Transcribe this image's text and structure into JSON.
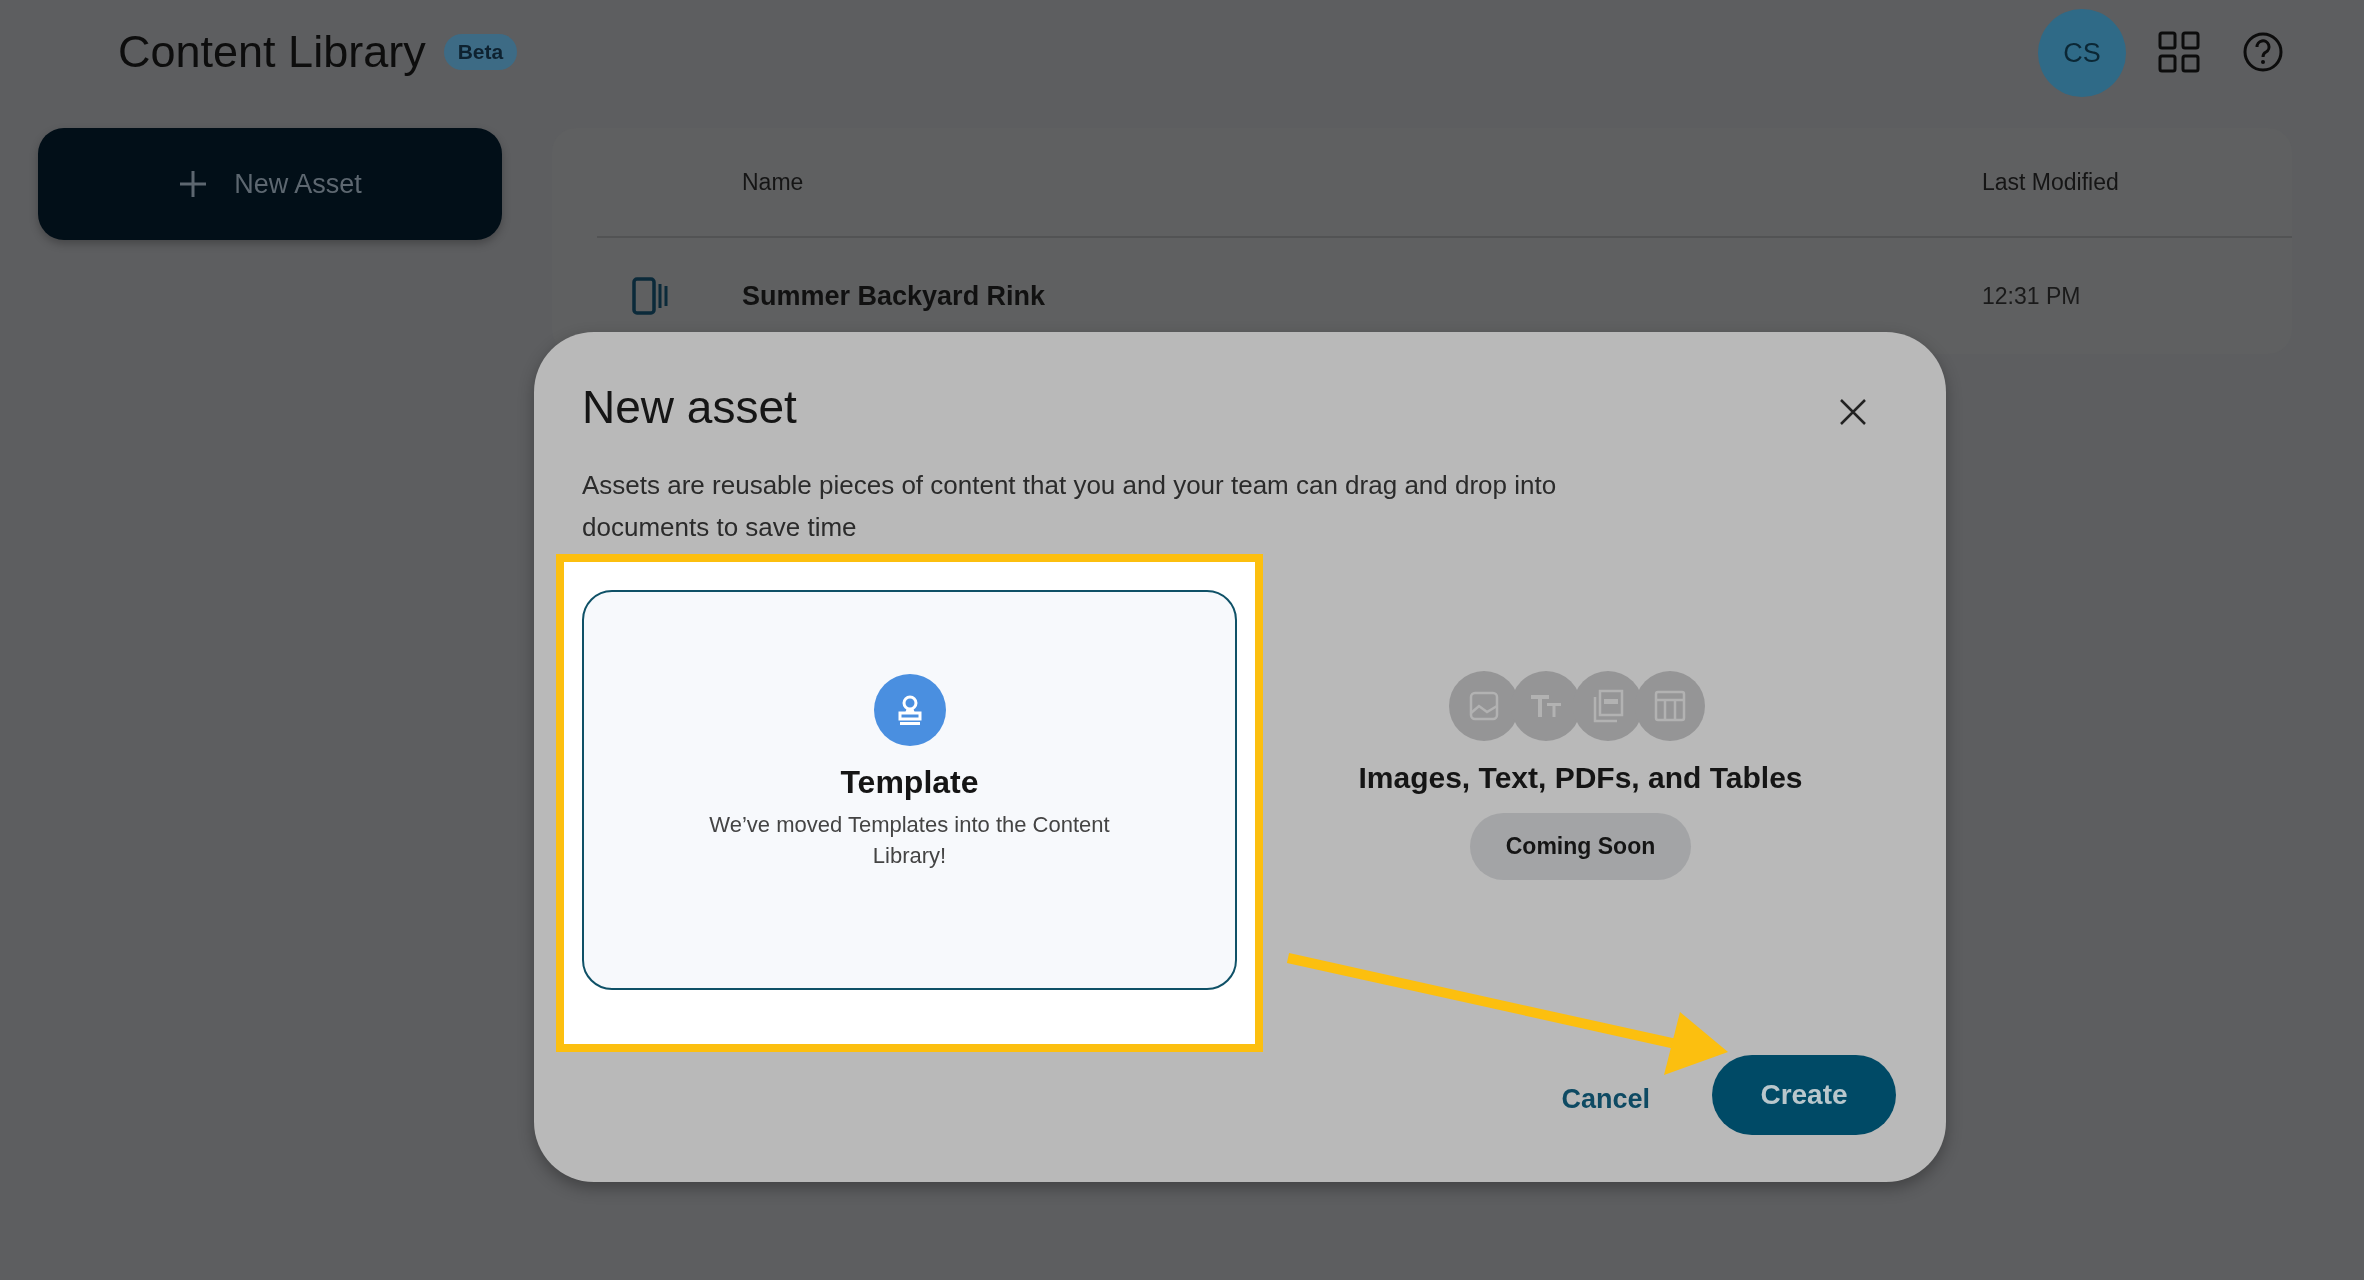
{
  "header": {
    "title": "Content Library",
    "badge": "Beta",
    "avatar": "CS"
  },
  "sidebar": {
    "new_button": "New Asset"
  },
  "table": {
    "columns": [
      "Name",
      "Last Modified"
    ],
    "rows": [
      {
        "name": "Summer Backyard Rink",
        "last_modified": "12:31 PM"
      }
    ]
  },
  "dialog": {
    "title": "New asset",
    "description": "Assets are reusable pieces of content that you and your team can drag and drop into documents to save time",
    "options": [
      {
        "kind": "template",
        "title": "Template",
        "description": "We’ve moved Templates into the Content Library!",
        "selected": true
      },
      {
        "kind": "media",
        "title": "Images, Text, PDFs, and Tables",
        "badge": "Coming Soon",
        "selected": false
      }
    ],
    "buttons": [
      {
        "kind": "secondary",
        "label": "Cancel"
      },
      {
        "kind": "primary",
        "label": "Create"
      }
    ]
  }
}
